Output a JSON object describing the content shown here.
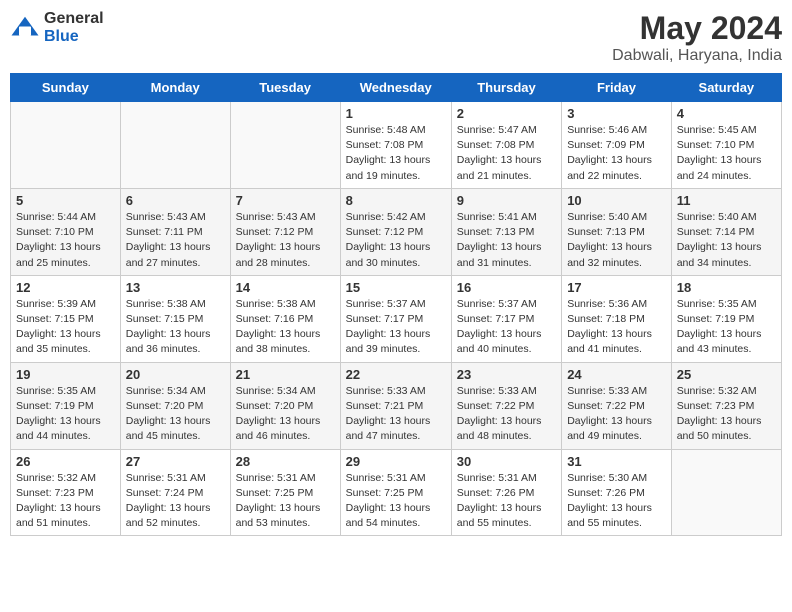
{
  "header": {
    "logo_general": "General",
    "logo_blue": "Blue",
    "title": "May 2024",
    "subtitle": "Dabwali, Haryana, India"
  },
  "days_of_week": [
    "Sunday",
    "Monday",
    "Tuesday",
    "Wednesday",
    "Thursday",
    "Friday",
    "Saturday"
  ],
  "weeks": [
    [
      {
        "day": "",
        "info": ""
      },
      {
        "day": "",
        "info": ""
      },
      {
        "day": "",
        "info": ""
      },
      {
        "day": "1",
        "sunrise": "Sunrise: 5:48 AM",
        "sunset": "Sunset: 7:08 PM",
        "daylight": "Daylight: 13 hours and 19 minutes."
      },
      {
        "day": "2",
        "sunrise": "Sunrise: 5:47 AM",
        "sunset": "Sunset: 7:08 PM",
        "daylight": "Daylight: 13 hours and 21 minutes."
      },
      {
        "day": "3",
        "sunrise": "Sunrise: 5:46 AM",
        "sunset": "Sunset: 7:09 PM",
        "daylight": "Daylight: 13 hours and 22 minutes."
      },
      {
        "day": "4",
        "sunrise": "Sunrise: 5:45 AM",
        "sunset": "Sunset: 7:10 PM",
        "daylight": "Daylight: 13 hours and 24 minutes."
      }
    ],
    [
      {
        "day": "5",
        "sunrise": "Sunrise: 5:44 AM",
        "sunset": "Sunset: 7:10 PM",
        "daylight": "Daylight: 13 hours and 25 minutes."
      },
      {
        "day": "6",
        "sunrise": "Sunrise: 5:43 AM",
        "sunset": "Sunset: 7:11 PM",
        "daylight": "Daylight: 13 hours and 27 minutes."
      },
      {
        "day": "7",
        "sunrise": "Sunrise: 5:43 AM",
        "sunset": "Sunset: 7:12 PM",
        "daylight": "Daylight: 13 hours and 28 minutes."
      },
      {
        "day": "8",
        "sunrise": "Sunrise: 5:42 AM",
        "sunset": "Sunset: 7:12 PM",
        "daylight": "Daylight: 13 hours and 30 minutes."
      },
      {
        "day": "9",
        "sunrise": "Sunrise: 5:41 AM",
        "sunset": "Sunset: 7:13 PM",
        "daylight": "Daylight: 13 hours and 31 minutes."
      },
      {
        "day": "10",
        "sunrise": "Sunrise: 5:40 AM",
        "sunset": "Sunset: 7:13 PM",
        "daylight": "Daylight: 13 hours and 32 minutes."
      },
      {
        "day": "11",
        "sunrise": "Sunrise: 5:40 AM",
        "sunset": "Sunset: 7:14 PM",
        "daylight": "Daylight: 13 hours and 34 minutes."
      }
    ],
    [
      {
        "day": "12",
        "sunrise": "Sunrise: 5:39 AM",
        "sunset": "Sunset: 7:15 PM",
        "daylight": "Daylight: 13 hours and 35 minutes."
      },
      {
        "day": "13",
        "sunrise": "Sunrise: 5:38 AM",
        "sunset": "Sunset: 7:15 PM",
        "daylight": "Daylight: 13 hours and 36 minutes."
      },
      {
        "day": "14",
        "sunrise": "Sunrise: 5:38 AM",
        "sunset": "Sunset: 7:16 PM",
        "daylight": "Daylight: 13 hours and 38 minutes."
      },
      {
        "day": "15",
        "sunrise": "Sunrise: 5:37 AM",
        "sunset": "Sunset: 7:17 PM",
        "daylight": "Daylight: 13 hours and 39 minutes."
      },
      {
        "day": "16",
        "sunrise": "Sunrise: 5:37 AM",
        "sunset": "Sunset: 7:17 PM",
        "daylight": "Daylight: 13 hours and 40 minutes."
      },
      {
        "day": "17",
        "sunrise": "Sunrise: 5:36 AM",
        "sunset": "Sunset: 7:18 PM",
        "daylight": "Daylight: 13 hours and 41 minutes."
      },
      {
        "day": "18",
        "sunrise": "Sunrise: 5:35 AM",
        "sunset": "Sunset: 7:19 PM",
        "daylight": "Daylight: 13 hours and 43 minutes."
      }
    ],
    [
      {
        "day": "19",
        "sunrise": "Sunrise: 5:35 AM",
        "sunset": "Sunset: 7:19 PM",
        "daylight": "Daylight: 13 hours and 44 minutes."
      },
      {
        "day": "20",
        "sunrise": "Sunrise: 5:34 AM",
        "sunset": "Sunset: 7:20 PM",
        "daylight": "Daylight: 13 hours and 45 minutes."
      },
      {
        "day": "21",
        "sunrise": "Sunrise: 5:34 AM",
        "sunset": "Sunset: 7:20 PM",
        "daylight": "Daylight: 13 hours and 46 minutes."
      },
      {
        "day": "22",
        "sunrise": "Sunrise: 5:33 AM",
        "sunset": "Sunset: 7:21 PM",
        "daylight": "Daylight: 13 hours and 47 minutes."
      },
      {
        "day": "23",
        "sunrise": "Sunrise: 5:33 AM",
        "sunset": "Sunset: 7:22 PM",
        "daylight": "Daylight: 13 hours and 48 minutes."
      },
      {
        "day": "24",
        "sunrise": "Sunrise: 5:33 AM",
        "sunset": "Sunset: 7:22 PM",
        "daylight": "Daylight: 13 hours and 49 minutes."
      },
      {
        "day": "25",
        "sunrise": "Sunrise: 5:32 AM",
        "sunset": "Sunset: 7:23 PM",
        "daylight": "Daylight: 13 hours and 50 minutes."
      }
    ],
    [
      {
        "day": "26",
        "sunrise": "Sunrise: 5:32 AM",
        "sunset": "Sunset: 7:23 PM",
        "daylight": "Daylight: 13 hours and 51 minutes."
      },
      {
        "day": "27",
        "sunrise": "Sunrise: 5:31 AM",
        "sunset": "Sunset: 7:24 PM",
        "daylight": "Daylight: 13 hours and 52 minutes."
      },
      {
        "day": "28",
        "sunrise": "Sunrise: 5:31 AM",
        "sunset": "Sunset: 7:25 PM",
        "daylight": "Daylight: 13 hours and 53 minutes."
      },
      {
        "day": "29",
        "sunrise": "Sunrise: 5:31 AM",
        "sunset": "Sunset: 7:25 PM",
        "daylight": "Daylight: 13 hours and 54 minutes."
      },
      {
        "day": "30",
        "sunrise": "Sunrise: 5:31 AM",
        "sunset": "Sunset: 7:26 PM",
        "daylight": "Daylight: 13 hours and 55 minutes."
      },
      {
        "day": "31",
        "sunrise": "Sunrise: 5:30 AM",
        "sunset": "Sunset: 7:26 PM",
        "daylight": "Daylight: 13 hours and 55 minutes."
      },
      {
        "day": "",
        "info": ""
      }
    ]
  ]
}
